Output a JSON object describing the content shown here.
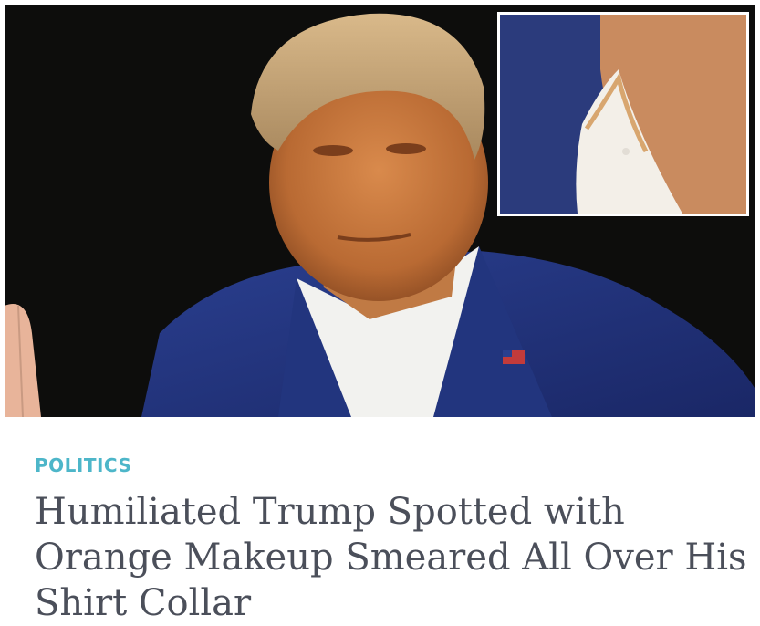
{
  "article": {
    "category": "POLITICS",
    "headline_lines": [
      "Humiliated Trump Spotted with",
      "Orange Makeup Smeared All Over His",
      "Shirt Collar"
    ]
  },
  "colors": {
    "category": "#4db6c9",
    "headline": "#4b4f5a",
    "background": "#ffffff"
  }
}
